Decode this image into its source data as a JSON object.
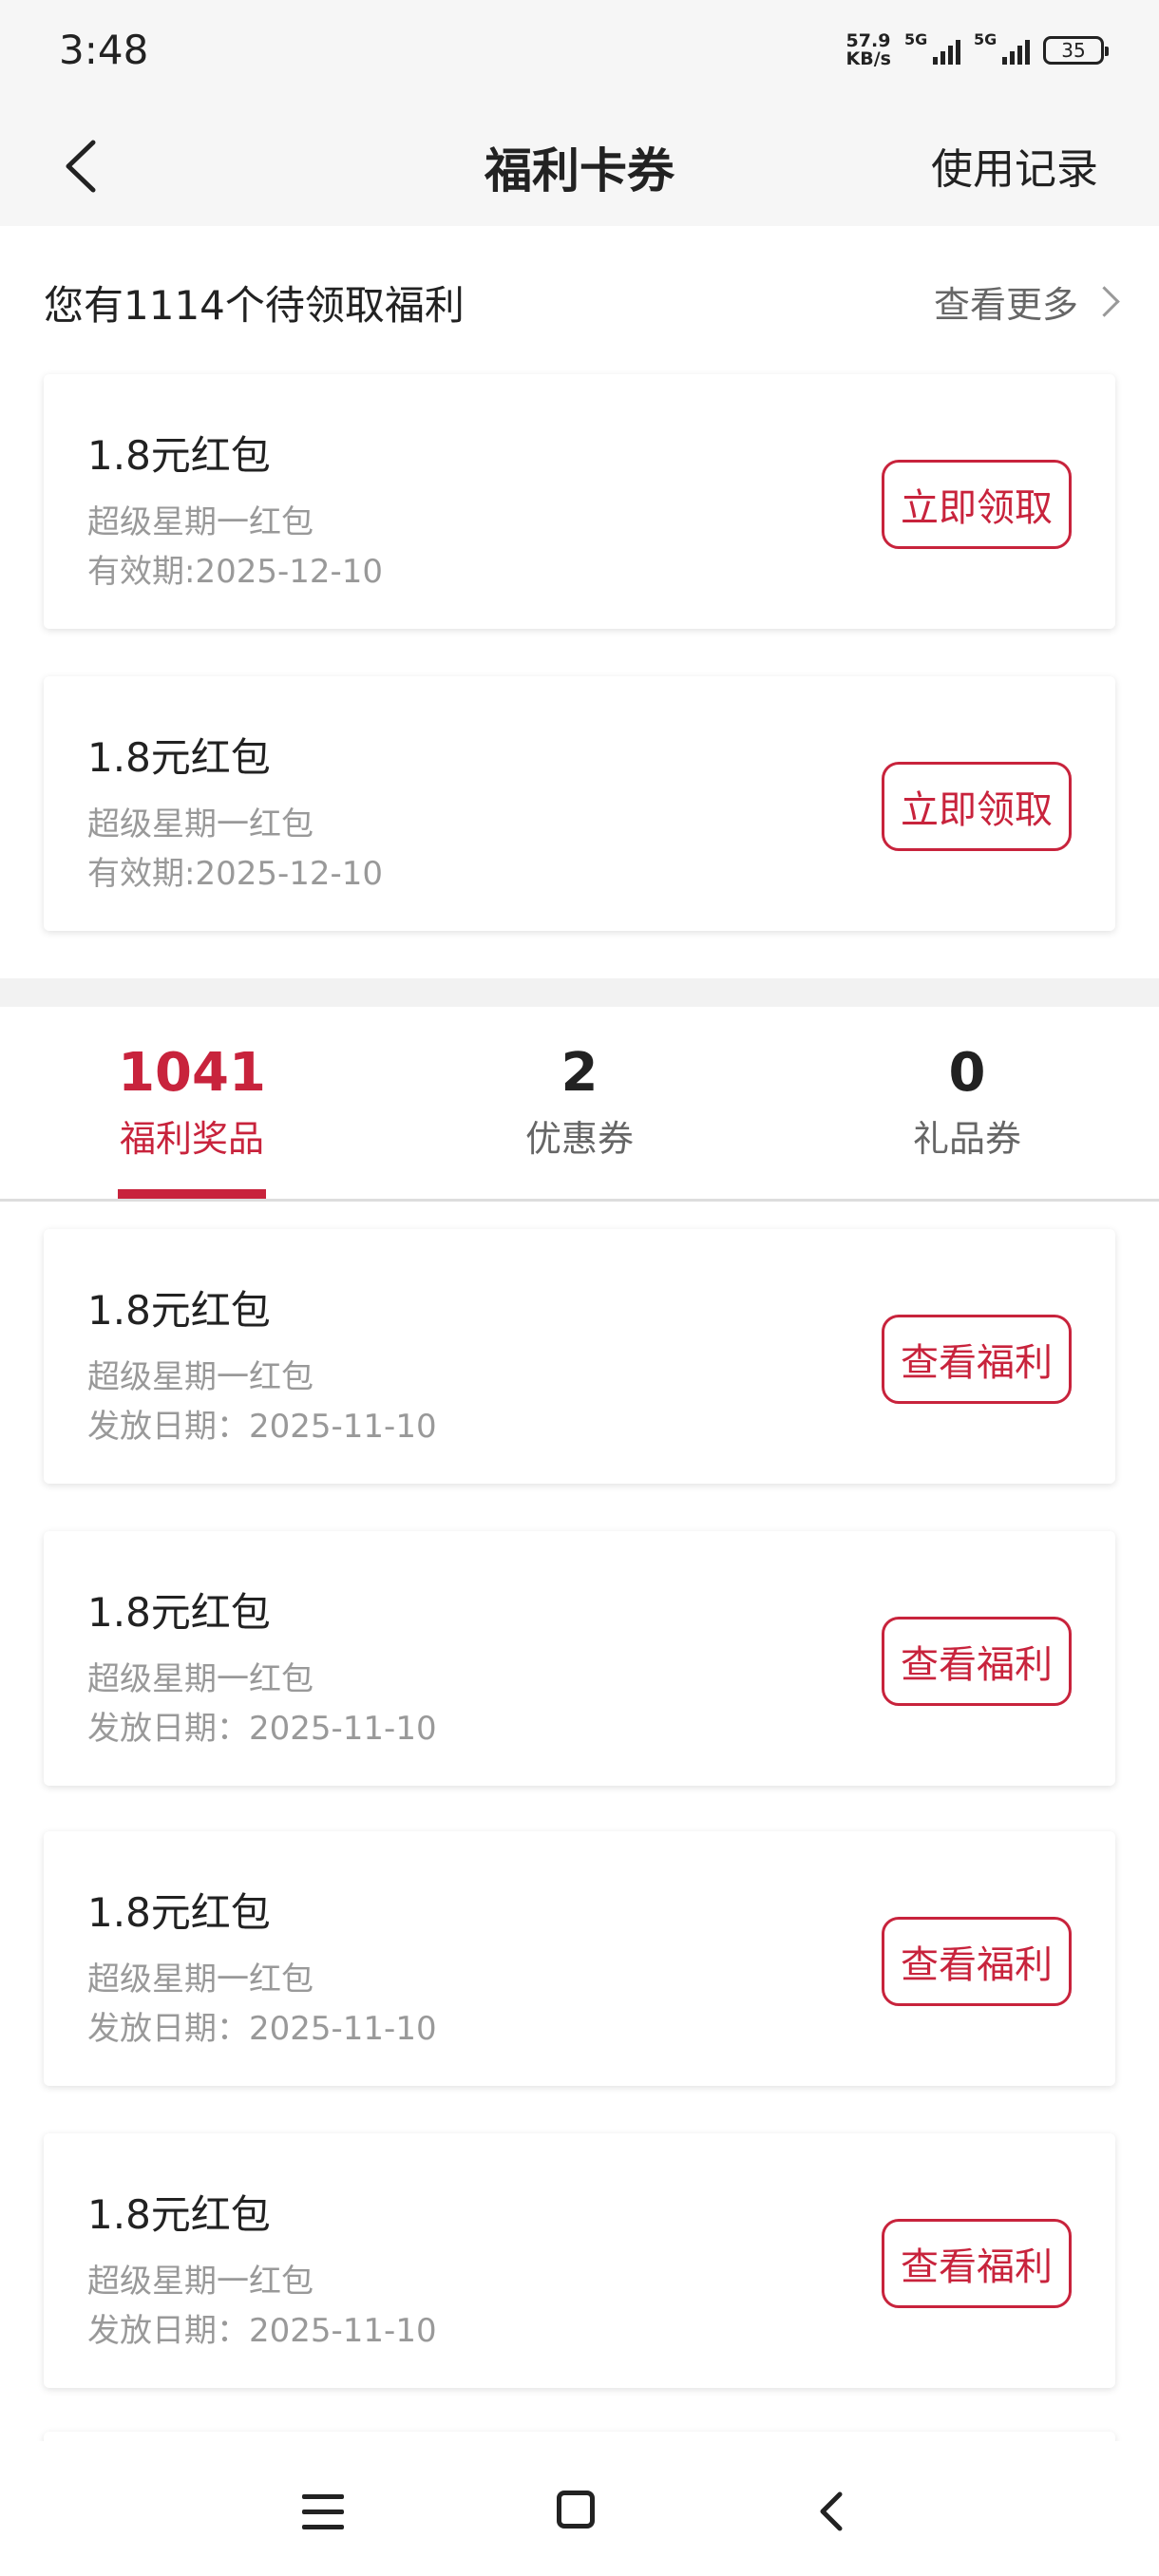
{
  "status": {
    "time": "3:48",
    "net_speed_value": "57.9",
    "net_speed_unit": "KB/s",
    "signal_label": "5G",
    "battery": "35"
  },
  "nav": {
    "title": "福利卡券",
    "record": "使用记录"
  },
  "pending": {
    "summary": "您有1114个待领取福利",
    "more": "查看更多"
  },
  "pending_cards": [
    {
      "title": "1.8元红包",
      "sub": "超级星期一红包",
      "date": "有效期:2025-12-10",
      "button": "立即领取"
    },
    {
      "title": "1.8元红包",
      "sub": "超级星期一红包",
      "date": "有效期:2025-12-10",
      "button": "立即领取"
    }
  ],
  "tabs": [
    {
      "count": "1041",
      "label": "福利奖品"
    },
    {
      "count": "2",
      "label": "优惠券"
    },
    {
      "count": "0",
      "label": "礼品券"
    }
  ],
  "welfare_cards": [
    {
      "title": "1.8元红包",
      "sub": "超级星期一红包",
      "date": "发放日期：2025-11-10",
      "button": "查看福利"
    },
    {
      "title": "1.8元红包",
      "sub": "超级星期一红包",
      "date": "发放日期：2025-11-10",
      "button": "查看福利"
    },
    {
      "title": "1.8元红包",
      "sub": "超级星期一红包",
      "date": "发放日期：2025-11-10",
      "button": "查看福利"
    },
    {
      "title": "1.8元红包",
      "sub": "超级星期一红包",
      "date": "发放日期：2025-11-10",
      "button": "查看福利"
    }
  ],
  "colors": {
    "accent": "#c8233c",
    "text": "#222222",
    "muted": "#999999",
    "page_bg": "#f2f2f2"
  }
}
